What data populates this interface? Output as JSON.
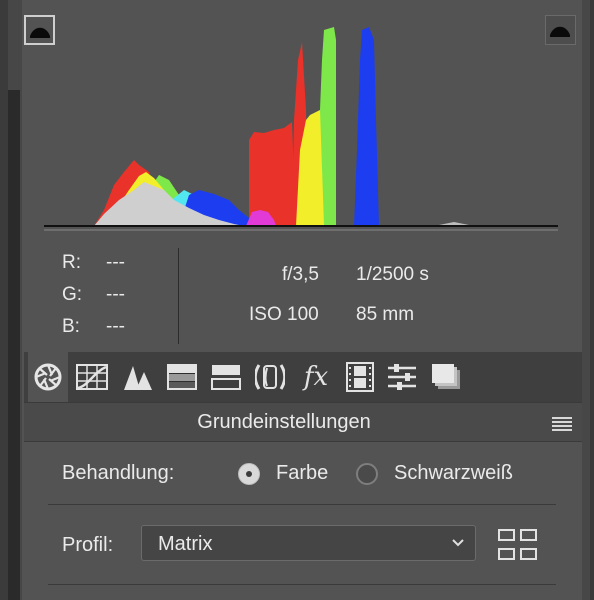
{
  "readout": {
    "r_label": "R:",
    "r_value": "---",
    "g_label": "G:",
    "g_value": "---",
    "b_label": "B:",
    "b_value": "---",
    "aperture": "f/3,5",
    "shutter": "1/2500 s",
    "iso": "ISO 100",
    "focal_length": "85 mm"
  },
  "tabs": [
    {
      "icon": "aperture-icon",
      "active": true
    },
    {
      "icon": "tone-curve-icon"
    },
    {
      "icon": "detail-icon"
    },
    {
      "icon": "hsl-icon"
    },
    {
      "icon": "split-toning-icon"
    },
    {
      "icon": "lens-corrections-icon"
    },
    {
      "icon": "effects-icon",
      "label": "fx"
    },
    {
      "icon": "camera-calibration-icon"
    },
    {
      "icon": "presets-icon"
    },
    {
      "icon": "snapshots-icon"
    }
  ],
  "section": {
    "title": "Grundeinstellungen"
  },
  "treatment": {
    "label": "Behandlung:",
    "option_color": "Farbe",
    "option_bw": "Schwarzweiß",
    "selected": "Farbe"
  },
  "profile": {
    "label": "Profil:",
    "value": "Matrix"
  },
  "colors": {
    "panel": "#535353",
    "red": "#e8322a",
    "green": "#7ee84a",
    "blue": "#1d3df0",
    "yellow": "#f2ee2a",
    "cyan": "#52e6f0",
    "magenta": "#e23ad6",
    "gray": "#cfcfcf"
  }
}
